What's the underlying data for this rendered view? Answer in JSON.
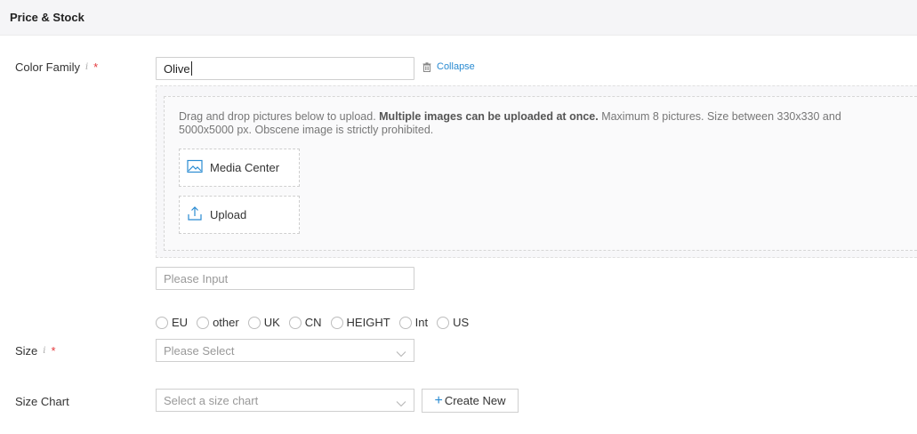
{
  "section": {
    "title": "Price & Stock"
  },
  "color_family": {
    "label": "Color Family",
    "info": "i",
    "required": "*",
    "value": "Olive",
    "collapse_label": "Collapse",
    "upload_description_pre": "Drag and drop pictures below to upload. ",
    "upload_description_bold": "Multiple images can be uploaded at once.",
    "upload_description_post": " Maximum 8 pictures. Size between 330x330 and 5000x5000 px. Obscene image is strictly prohibited.",
    "media_center_label": "Media Center",
    "upload_label": "Upload",
    "extra_input_placeholder": "Please Input"
  },
  "size": {
    "label": "Size",
    "info": "i",
    "required": "*",
    "options": [
      "EU",
      "other",
      "UK",
      "CN",
      "HEIGHT",
      "Int",
      "US"
    ],
    "select_placeholder": "Please Select"
  },
  "size_chart": {
    "label": "Size Chart",
    "select_placeholder": "Select a size chart",
    "create_new_label": "Create New",
    "create_new_prefix": "+"
  },
  "colors": {
    "accent": "#2a8bd2",
    "required": "#e4393c",
    "header_bg": "#f5f5f7"
  }
}
